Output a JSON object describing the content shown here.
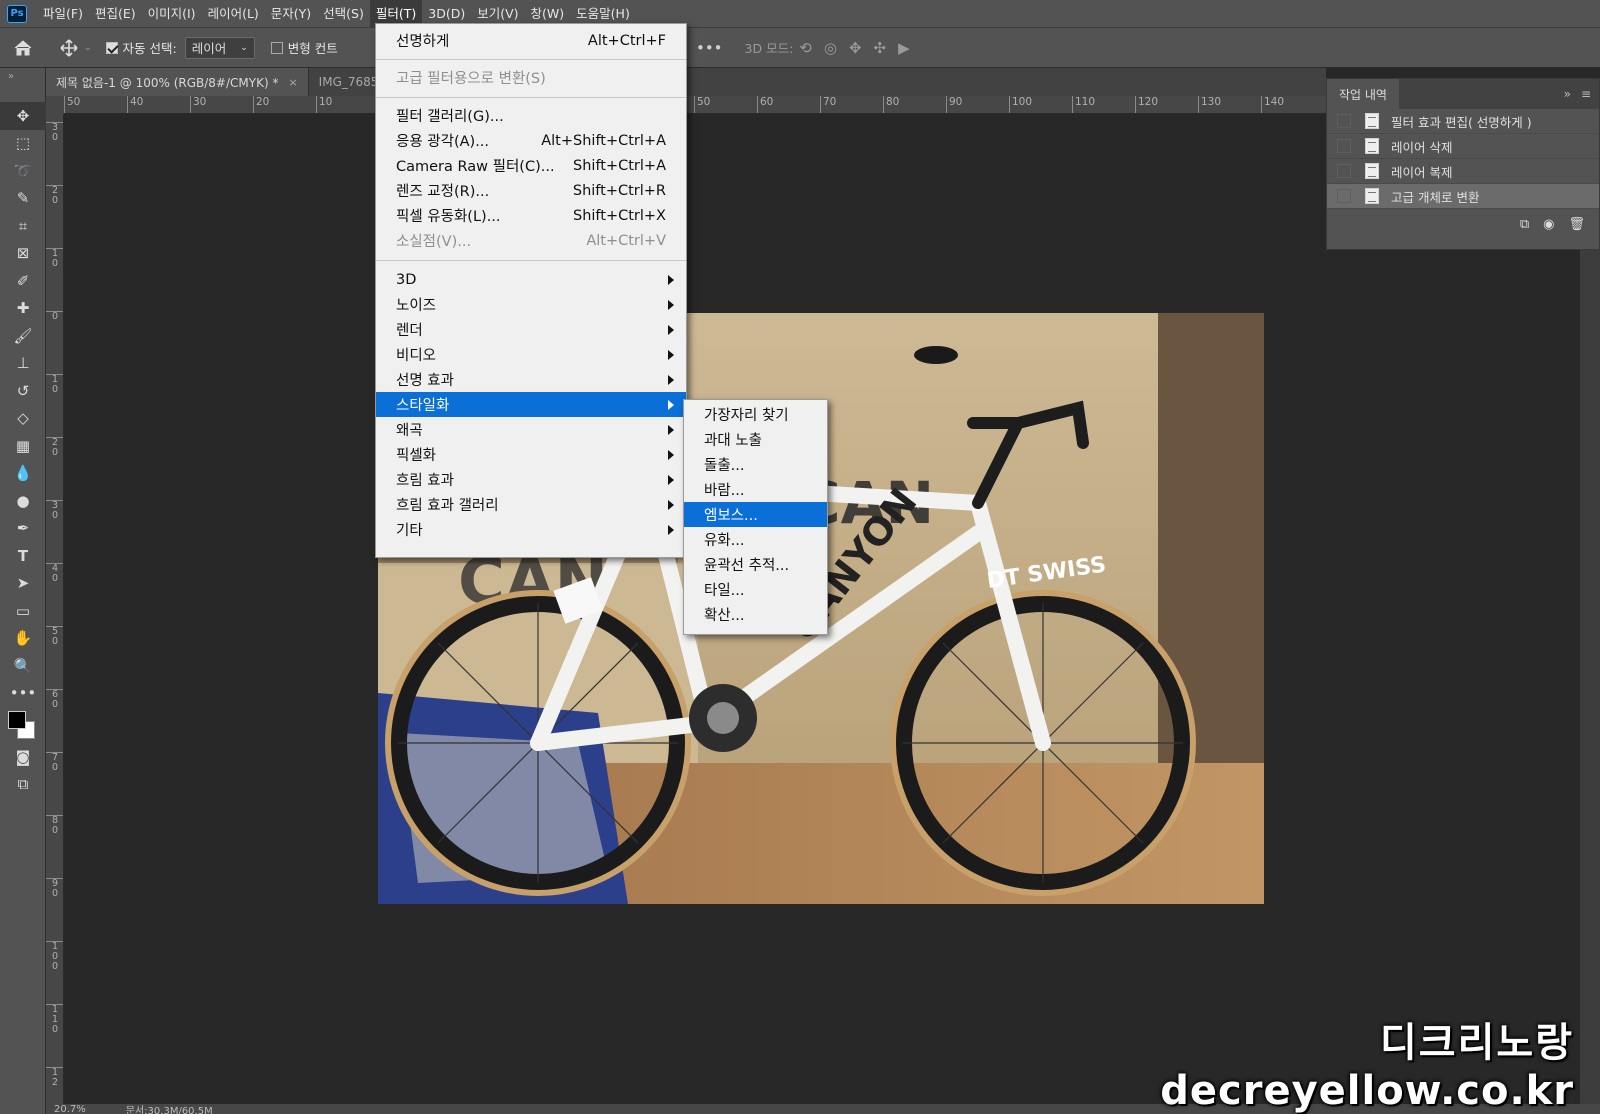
{
  "menubar": {
    "logo": "Ps",
    "items": [
      "파일(F)",
      "편집(E)",
      "이미지(I)",
      "레이어(L)",
      "문자(Y)",
      "선택(S)",
      "필터(T)",
      "3D(D)",
      "보기(V)",
      "창(W)",
      "도움말(H)"
    ],
    "active": "필터(T)"
  },
  "options": {
    "auto_select_label": "자동 선택:",
    "layer_select_value": "레이어",
    "transform_label": "변형 컨트",
    "mode_3d_label": "3D 모드:",
    "more": "•••"
  },
  "tabs": [
    {
      "label": "제목 없음-1 @ 100% (RGB/8#/CMYK) *",
      "close": "×"
    },
    {
      "label": "IMG_7685"
    }
  ],
  "ruler_h": [
    "50",
    "40",
    "30",
    "20",
    "10",
    "",
    "",
    "",
    "",
    "",
    "50",
    "60",
    "70",
    "80",
    "90",
    "100",
    "110",
    "120",
    "130",
    "140"
  ],
  "ruler_v": [
    "3\n0",
    "2\n0",
    "1\n0",
    "0",
    "1\n0",
    "2\n0",
    "3\n0",
    "4\n0",
    "5\n0",
    "6\n0",
    "7\n0",
    "8\n0",
    "9\n0",
    "1\n0\n0",
    "1\n1\n0",
    "1\n2"
  ],
  "filter_menu": {
    "items": [
      {
        "label": "선명하게",
        "shortcut": "Alt+Ctrl+F"
      },
      {
        "label": "고급 필터용으로 변환(S)",
        "disabled": true
      },
      {
        "label": "필터 갤러리(G)..."
      },
      {
        "label": "응용 광각(A)...",
        "shortcut": "Alt+Shift+Ctrl+A"
      },
      {
        "label": "Camera Raw 필터(C)...",
        "shortcut": "Shift+Ctrl+A"
      },
      {
        "label": "렌즈 교정(R)...",
        "shortcut": "Shift+Ctrl+R"
      },
      {
        "label": "픽셀 유동화(L)...",
        "shortcut": "Shift+Ctrl+X"
      },
      {
        "label": "소실점(V)...",
        "shortcut": "Alt+Ctrl+V",
        "disabled": true
      },
      {
        "label": "3D"
      },
      {
        "label": "노이즈"
      },
      {
        "label": "렌더"
      },
      {
        "label": "비디오"
      },
      {
        "label": "선명 효과"
      },
      {
        "label": "스타일화"
      },
      {
        "label": "왜곡"
      },
      {
        "label": "픽셀화"
      },
      {
        "label": "흐림 효과"
      },
      {
        "label": "흐림 효과 갤러리"
      },
      {
        "label": "기타"
      }
    ]
  },
  "stylize_submenu": {
    "items": [
      "가장자리 찾기",
      "과대 노출",
      "돌출...",
      "바람...",
      "엠보스...",
      "유화...",
      "윤곽선 추적...",
      "타일...",
      "확산..."
    ],
    "highlighted": "엠보스..."
  },
  "history_panel": {
    "title": "작업 내역",
    "collapse": "»",
    "menu": "≡",
    "items": [
      "필터 효과 편집( 선명하게 )",
      "레이어 삭제",
      "레이어 복제",
      "고급 개체로 변환"
    ]
  },
  "photo": {
    "brand": "CANYON",
    "rim_text": "DT SWISS"
  },
  "status": {
    "zoom": "20.7%",
    "doc": "문서:30.3M/60.5M"
  },
  "watermark": {
    "korean": "디크리노랑",
    "url": "decreyellow.co.kr"
  },
  "colors": {
    "menu_highlight": "#0a6fd6",
    "panel_bg": "#535353",
    "canvas_bg": "#282828",
    "menu_bg": "#f0f0f0"
  }
}
